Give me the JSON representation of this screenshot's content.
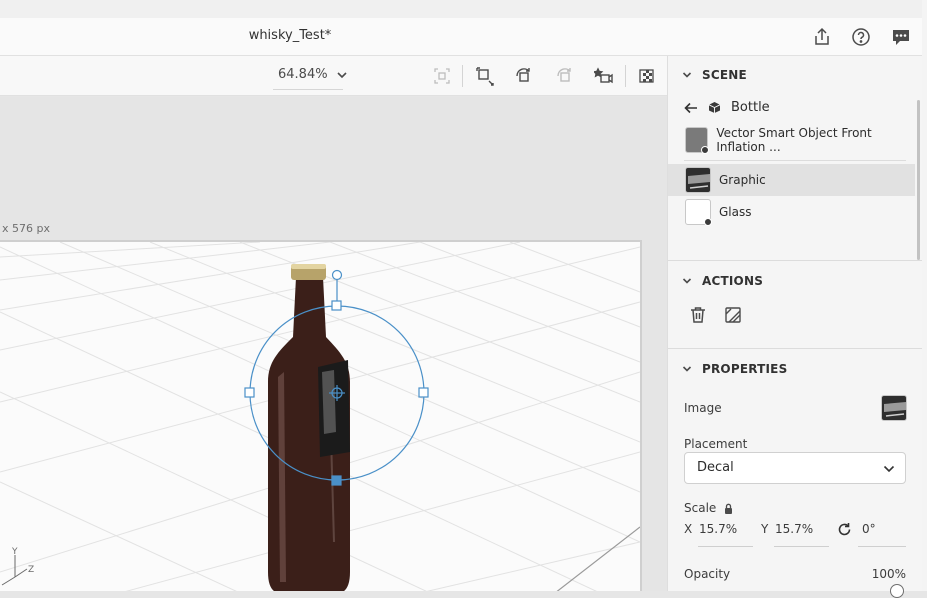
{
  "document": {
    "title": "whisky_Test*",
    "canvas_size_label": "x 576 px"
  },
  "header_icons": [
    "share-icon",
    "help-icon",
    "feedback-icon"
  ],
  "toolbar": {
    "zoom_value": "64.84%",
    "tools": [
      "frame-icon",
      "transform-icon",
      "rotate-object-icon",
      "orbit-icon",
      "camera-bookmark-icon",
      "render-preview-icon"
    ]
  },
  "scene": {
    "heading": "SCENE",
    "breadcrumb": "Bottle",
    "items": [
      {
        "label": "Vector Smart Object Front Inflation ...",
        "thumb_color": "#7a7a7a",
        "selected": false
      },
      {
        "label": "Graphic",
        "thumb_color": "#3a3a3a",
        "selected": true
      },
      {
        "label": "Glass",
        "thumb_color": "#ffffff",
        "selected": false
      }
    ]
  },
  "actions": {
    "heading": "ACTIONS",
    "icons": [
      "trash-icon",
      "edit-graphic-icon"
    ]
  },
  "properties": {
    "heading": "PROPERTIES",
    "image_label": "Image",
    "placement_label": "Placement",
    "placement_value": "Decal",
    "scale_label": "Scale",
    "x_label": "X",
    "x_value": "15.7%",
    "y_label": "Y",
    "y_value": "15.7%",
    "rotation_value": "0°",
    "opacity_label": "Opacity",
    "opacity_value": "100%"
  },
  "viewport": {
    "axis_y": "Y",
    "axis_z": "Z"
  },
  "colors": {
    "accent": "#2680eb",
    "gizmo": "#4a90c8",
    "bottle": "#3a1e18",
    "panel_bg": "#f5f5f5"
  }
}
